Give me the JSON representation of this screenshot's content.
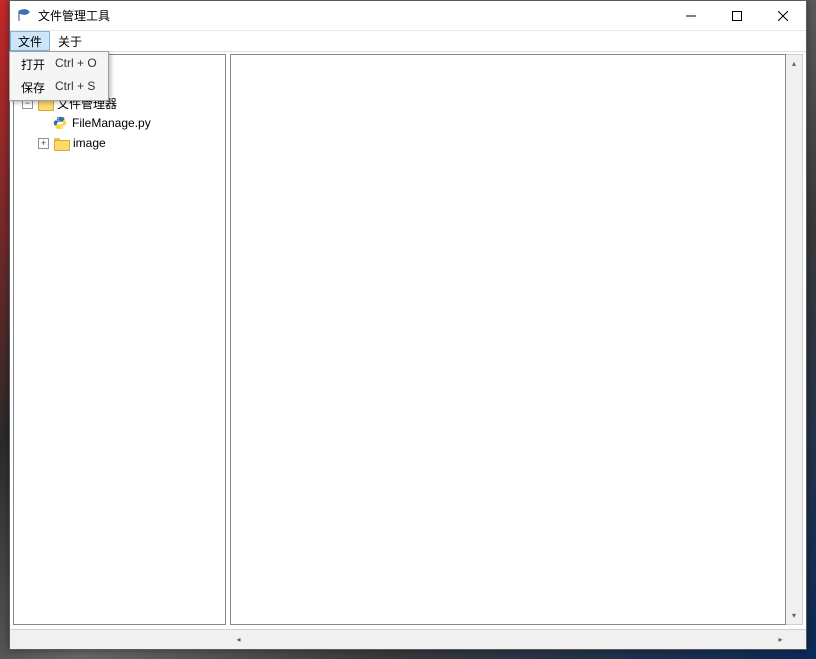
{
  "window": {
    "title": "文件管理工具"
  },
  "menubar": {
    "items": [
      {
        "label": "文件",
        "active": true
      },
      {
        "label": "关于",
        "active": false
      }
    ]
  },
  "dropdown": {
    "items": [
      {
        "label": "打开",
        "accelerator": "Ctrl + O"
      },
      {
        "label": "保存",
        "accelerator": "Ctrl + S"
      }
    ]
  },
  "tree": {
    "root": {
      "label": "文件管理器",
      "expanded": true,
      "children": [
        {
          "label": "FileManage.py",
          "type": "python"
        },
        {
          "label": "image",
          "type": "folder",
          "expanded": false
        }
      ]
    }
  },
  "editor": {
    "content": ""
  }
}
